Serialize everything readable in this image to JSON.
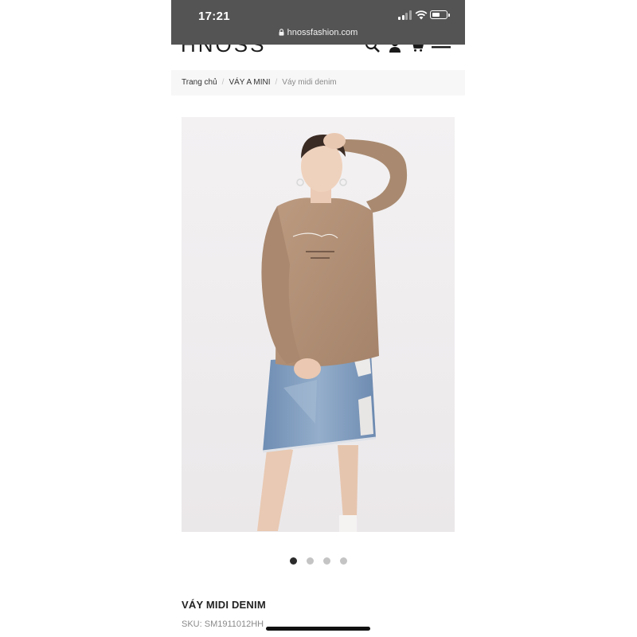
{
  "status_bar": {
    "time": "17:21",
    "url": "hnossfashion.com",
    "icons": [
      "lock-icon",
      "signal-icon",
      "wifi-icon",
      "battery-icon"
    ]
  },
  "header": {
    "logo": "HNOSS",
    "icons": [
      "search-icon",
      "account-icon",
      "cart-icon",
      "menu-icon"
    ]
  },
  "breadcrumb": {
    "items": [
      "Trang chủ",
      "VÁY A MINI",
      "Váy midi denim"
    ]
  },
  "gallery": {
    "total_images": 4,
    "active_index": 0
  },
  "product": {
    "title": "VÁY MIDI DENIM",
    "sku": "SKU: SM1911012HH"
  },
  "colors": {
    "status_bar_bg": "#545454",
    "sweater": "#b18e72",
    "denim": "#7f9bbc",
    "active_dot": "#2b2b2b"
  }
}
